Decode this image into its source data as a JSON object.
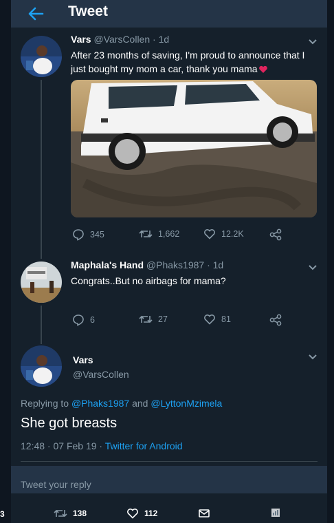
{
  "header": {
    "title": "Tweet"
  },
  "tweet1": {
    "name": "Vars",
    "handle_time": "@VarsCollen · 1d",
    "text_line1": "After 23 months of saving, I'm proud to announce that I",
    "text_line2": "just bought my mom a car, thank you mama",
    "emoji": "heart-icon",
    "replies": "345",
    "retweets": "1,662",
    "likes": "12.2K"
  },
  "tweet2": {
    "name": "Maphala's Hand",
    "handle_time": "@Phaks1987 · 1d",
    "text": "Congrats..But no airbags for mama?",
    "replies": "6",
    "retweets": "27",
    "likes": "81"
  },
  "main_tweet": {
    "name": "Vars",
    "handle": "@VarsCollen",
    "replying_prefix": "Replying to",
    "replying_user1": "@Phaks1987",
    "replying_and": "and",
    "replying_user2": "@LyttonMzimela",
    "text": "She got breasts",
    "timestamp": "12:48 · 07 Feb 19 · ",
    "source": "Twitter for Android"
  },
  "reply_box": {
    "placeholder": "Tweet your reply"
  },
  "bottom_bar": {
    "left_count": "3",
    "retweets": "138",
    "likes": "112"
  },
  "colors": {
    "background": "#15202b",
    "header": "#243447",
    "accent": "#1da1f2",
    "muted": "#8899a6",
    "heart": "#e0245e"
  }
}
